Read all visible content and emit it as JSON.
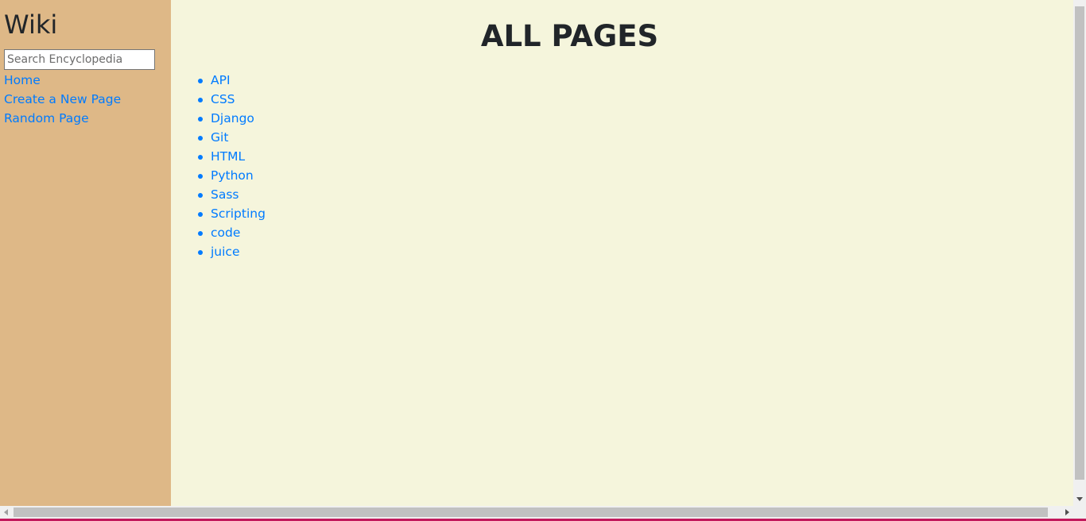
{
  "sidebar": {
    "title": "Wiki",
    "search": {
      "placeholder": "Search Encyclopedia",
      "value": ""
    },
    "nav": [
      {
        "label": "Home"
      },
      {
        "label": "Create a New Page"
      },
      {
        "label": "Random Page"
      }
    ]
  },
  "main": {
    "title": "ALL PAGES",
    "entries": [
      {
        "label": "API"
      },
      {
        "label": "CSS"
      },
      {
        "label": "Django"
      },
      {
        "label": "Git"
      },
      {
        "label": "HTML"
      },
      {
        "label": "Python"
      },
      {
        "label": "Sass"
      },
      {
        "label": "Scripting"
      },
      {
        "label": "code"
      },
      {
        "label": "juice"
      }
    ]
  },
  "colors": {
    "sidebar_bg": "#deb887",
    "main_bg": "#f5f5dc",
    "link": "#007bff",
    "text": "#212529"
  }
}
